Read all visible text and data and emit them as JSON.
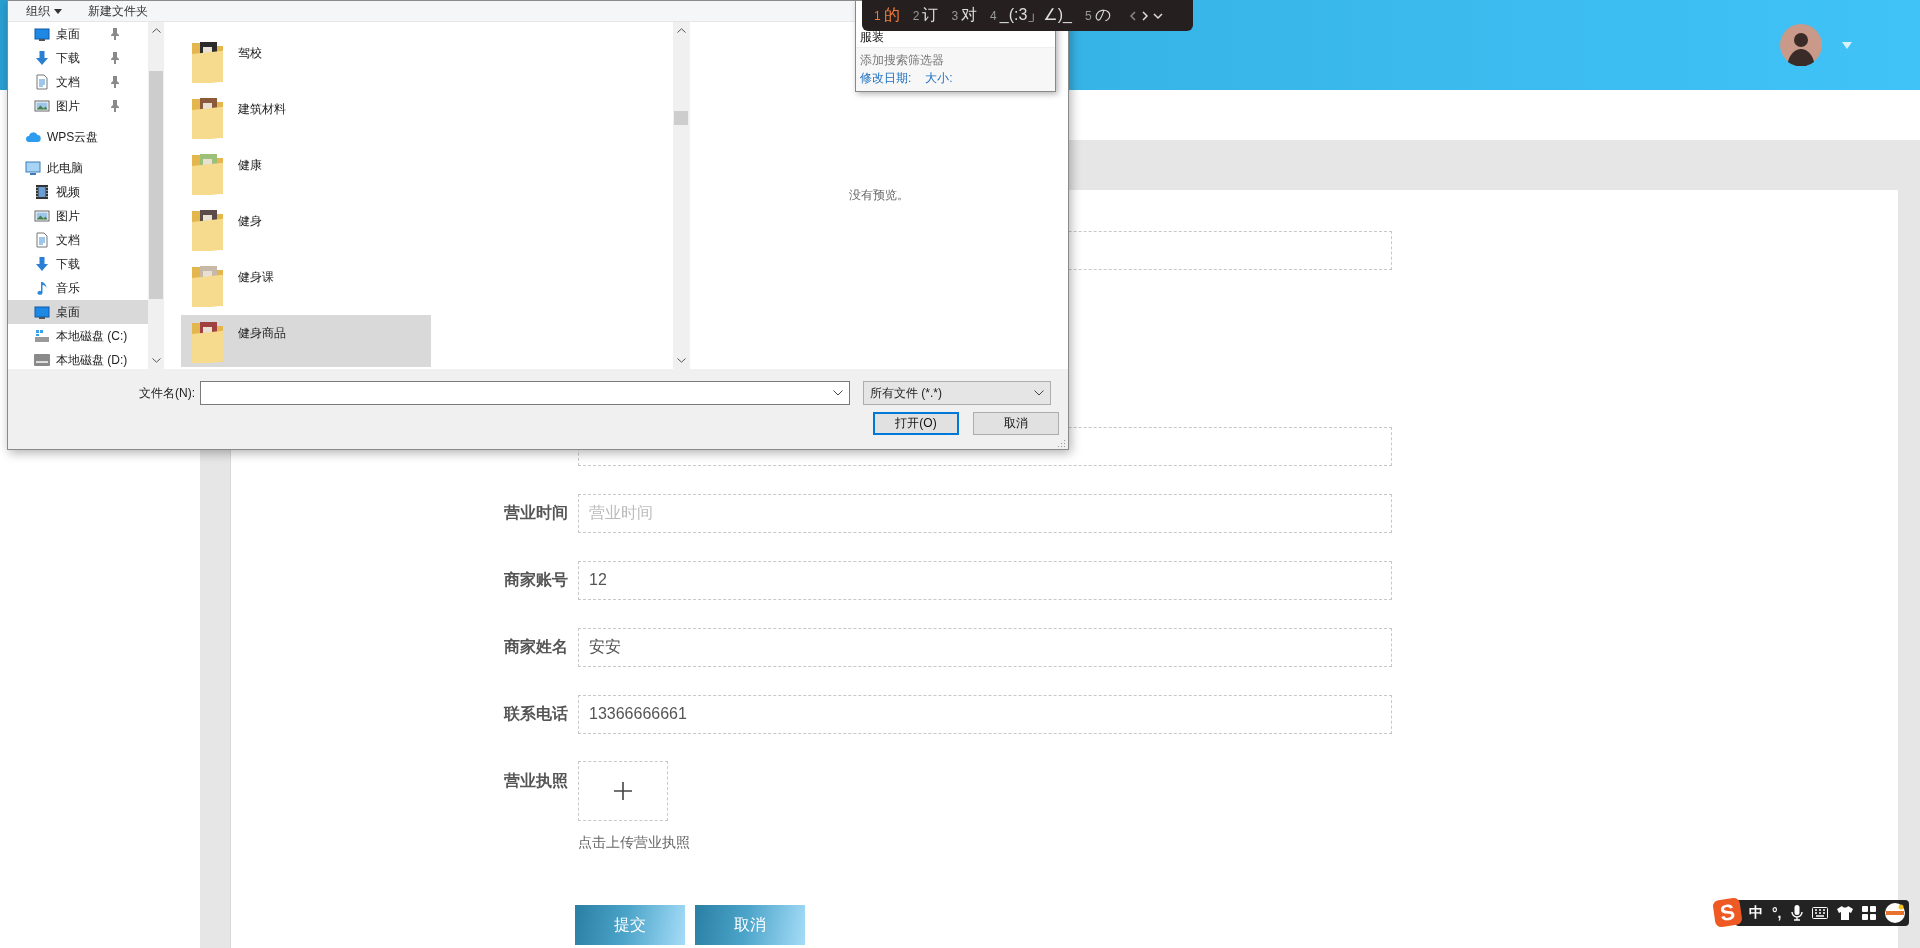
{
  "form": {
    "fields": [
      {
        "kind": "text"
      },
      {
        "kind": "text"
      },
      {
        "kind": "text",
        "label": "营业时间",
        "placeholder": "营业时间"
      },
      {
        "kind": "text",
        "label": "商家账号",
        "value": "12"
      },
      {
        "kind": "text",
        "label": "商家姓名",
        "value": "安安"
      },
      {
        "kind": "text",
        "label": "联系电话",
        "value": "13366666661"
      },
      {
        "kind": "upload",
        "label": "营业执照",
        "hint": "点击上传营业执照"
      }
    ],
    "buttons": [
      "提交",
      "取消"
    ]
  },
  "file_dialog": {
    "toolbar": [
      {
        "label": "组织",
        "kind": "menu"
      },
      {
        "label": "新建文件夹",
        "kind": "button"
      }
    ],
    "quick_access": [
      {
        "label": "桌面",
        "kind": "desktop",
        "pinned": true,
        "selected": false
      },
      {
        "label": "下载",
        "kind": "downloads",
        "pinned": true,
        "selected": false
      },
      {
        "label": "文档",
        "kind": "documents",
        "pinned": true,
        "selected": false
      },
      {
        "label": "图片",
        "kind": "pictures",
        "pinned": true,
        "selected": false
      }
    ],
    "nav": [
      {
        "label": "WPS云盘",
        "kind": "cloud",
        "selected": false
      },
      {
        "label": "此电脑",
        "kind": "computer",
        "selected": false,
        "children": [
          {
            "label": "视频",
            "kind": "videos",
            "selected": false
          },
          {
            "label": "图片",
            "kind": "pictures",
            "selected": false
          },
          {
            "label": "文档",
            "kind": "documents",
            "selected": false
          },
          {
            "label": "下载",
            "kind": "downloads",
            "selected": false
          },
          {
            "label": "音乐",
            "kind": "music",
            "selected": false
          },
          {
            "label": "桌面",
            "kind": "desktop",
            "selected": true
          },
          {
            "label": "本地磁盘 (C:)",
            "kind": "system_drive",
            "selected": false
          },
          {
            "label": "本地磁盘 (D:)",
            "kind": "drive",
            "selected": false
          }
        ]
      }
    ],
    "files": [
      {
        "name": "驾校",
        "selected": false
      },
      {
        "name": "建筑材料",
        "selected": false
      },
      {
        "name": "健康",
        "selected": false
      },
      {
        "name": "健身",
        "selected": false
      },
      {
        "name": "健身课",
        "selected": false
      },
      {
        "name": "健身商品",
        "selected": true
      }
    ],
    "preview": "没有预览。",
    "file_name_label": "文件名(N):",
    "file_type": "所有文件 (*.*)",
    "buttons": [
      {
        "label": "打开(O)",
        "default": true
      },
      {
        "label": "取消",
        "default": false
      }
    ]
  },
  "search_suggestions": {
    "items": [
      "服装"
    ],
    "filter_title": "添加搜索筛选器",
    "filters": [
      "修改日期:",
      "大小:"
    ]
  },
  "ime": {
    "candidates": [
      {
        "number": "1",
        "text": "的",
        "selected": true
      },
      {
        "number": "2",
        "text": "订",
        "selected": false
      },
      {
        "number": "3",
        "text": "对",
        "selected": false
      },
      {
        "number": "4",
        "text": "_(:3」∠)_",
        "selected": false
      },
      {
        "number": "5",
        "text": "の",
        "selected": false
      }
    ]
  },
  "ime_toolbar": {
    "logo": "S",
    "mode": "中",
    "punctuation": "°,"
  }
}
